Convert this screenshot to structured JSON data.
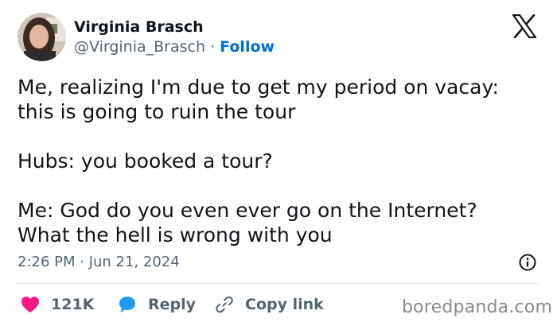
{
  "user": {
    "name": "Virginia Brasch",
    "handle": "@Virginia_Brasch",
    "separator": "·",
    "follow_label": "Follow"
  },
  "tweet": {
    "lines": [
      "Me, realizing I'm due to get my period on vacay:",
      "this is going to ruin the tour",
      "Hubs: you booked a tour?",
      "Me: God do you even ever go on the Internet?",
      "What the hell is wrong with you"
    ],
    "timestamp": "2:26 PM · Jun 21, 2024"
  },
  "actions": {
    "like_count": "121K",
    "reply_label": "Reply",
    "copy_link_label": "Copy link"
  },
  "watermark": "boredpanda.com",
  "icons": {
    "brand": "x-logo-icon",
    "like": "heart-icon",
    "reply": "speech-bubble-icon",
    "copy": "link-icon",
    "info": "info-icon"
  },
  "colors": {
    "like": "#f91880",
    "reply": "#1d9bf0",
    "follow": "#006fd6",
    "secondary_text": "#536471"
  }
}
